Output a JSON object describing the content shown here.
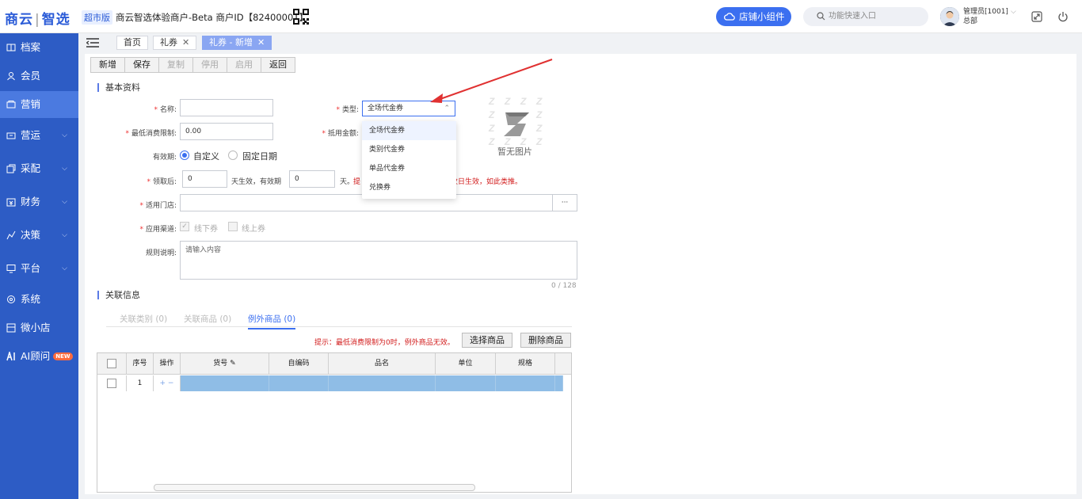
{
  "header": {
    "logo_left": "商云",
    "logo_right": "智选",
    "edition_badge": "超市版",
    "merchant_info": "商云智选体验商户-Beta  商户ID【82400001】",
    "shop_widget_label": "店铺小组件",
    "search_placeholder": "功能快速入口",
    "user_name": "管理员[1001]",
    "user_dept": "总部"
  },
  "sidebar": {
    "items": [
      {
        "label": "档案",
        "icon": "archive-icon",
        "has_arrow": false
      },
      {
        "label": "会员",
        "icon": "member-icon",
        "has_arrow": false
      },
      {
        "label": "营销",
        "icon": "marketing-icon",
        "has_arrow": false
      },
      {
        "label": "营运",
        "icon": "operation-icon",
        "has_arrow": true
      },
      {
        "label": "采配",
        "icon": "purchase-icon",
        "has_arrow": true
      },
      {
        "label": "财务",
        "icon": "finance-icon",
        "has_arrow": true
      },
      {
        "label": "决策",
        "icon": "decision-icon",
        "has_arrow": true
      },
      {
        "label": "平台",
        "icon": "platform-icon",
        "has_arrow": true
      },
      {
        "label": "系统",
        "icon": "system-icon",
        "has_arrow": false
      },
      {
        "label": "微小店",
        "icon": "shop-icon",
        "has_arrow": false
      },
      {
        "label": "AI顾问",
        "icon": "ai-icon",
        "has_arrow": false,
        "badge": "NEW"
      }
    ],
    "active": "营销"
  },
  "tabs": [
    {
      "label": "首页",
      "closable": false
    },
    {
      "label": "礼券",
      "closable": true
    },
    {
      "label": "礼券 - 新增",
      "closable": true,
      "active": true
    }
  ],
  "toolbar": {
    "buttons": [
      {
        "label": "新增",
        "disabled": false
      },
      {
        "label": "保存",
        "disabled": false
      },
      {
        "label": "复制",
        "disabled": true
      },
      {
        "label": "停用",
        "disabled": true
      },
      {
        "label": "启用",
        "disabled": true
      },
      {
        "label": "返回",
        "disabled": false
      }
    ]
  },
  "basic": {
    "section_title": "基本资料",
    "name_label": "名称:",
    "name_value": "",
    "type_label": "类型:",
    "type_value": "全场代金券",
    "min_spend_label": "最低消费限制:",
    "min_spend_value": "0.00",
    "deduct_label": "抵用金额:",
    "validity_label": "有效期:",
    "validity_custom": "自定义",
    "validity_fixed": "固定日期",
    "claim_label": "领取后:",
    "claim_days": "0",
    "claim_suffix_1": "天生效，有效期",
    "claim_valid_days": "0",
    "claim_suffix_2": "天。",
    "claim_hint_left": "提",
    "claim_hint_right": "次日生效，如此类推。",
    "stores_label": "适用门店:",
    "stores_value": "",
    "stores_btn": "···",
    "channel_label": "应用渠道:",
    "channel_offline": "线下券",
    "channel_online": "线上券",
    "rules_label": "规则说明:",
    "rules_placeholder": "请输入内容",
    "rules_counter": "0 / 128",
    "no_image_text": "暂无图片"
  },
  "type_dropdown": {
    "options": [
      "全场代金券",
      "类别代金券",
      "单品代金券",
      "兑换券"
    ],
    "selected": "全场代金券"
  },
  "related": {
    "section_title": "关联信息",
    "subtabs": [
      {
        "label": "关联类别 (0)",
        "active": false
      },
      {
        "label": "关联商品 (0)",
        "active": false
      },
      {
        "label": "例外商品 (0)",
        "active": true
      }
    ],
    "hint": "提示：最低消费限制为0时，例外商品无效。",
    "select_goods_btn": "选择商品",
    "delete_goods_btn": "删除商品",
    "grid": {
      "columns": [
        "",
        "序号",
        "操作",
        "货号",
        "自编码",
        "品名",
        "单位",
        "规格"
      ],
      "rows": [
        {
          "seq": "1",
          "ops": "+ −"
        }
      ]
    }
  },
  "colors": {
    "sidebar_bg": "#2d5cc5",
    "accent": "#3b6ff0",
    "required": "#e33",
    "hint_red": "#d21c1c"
  }
}
